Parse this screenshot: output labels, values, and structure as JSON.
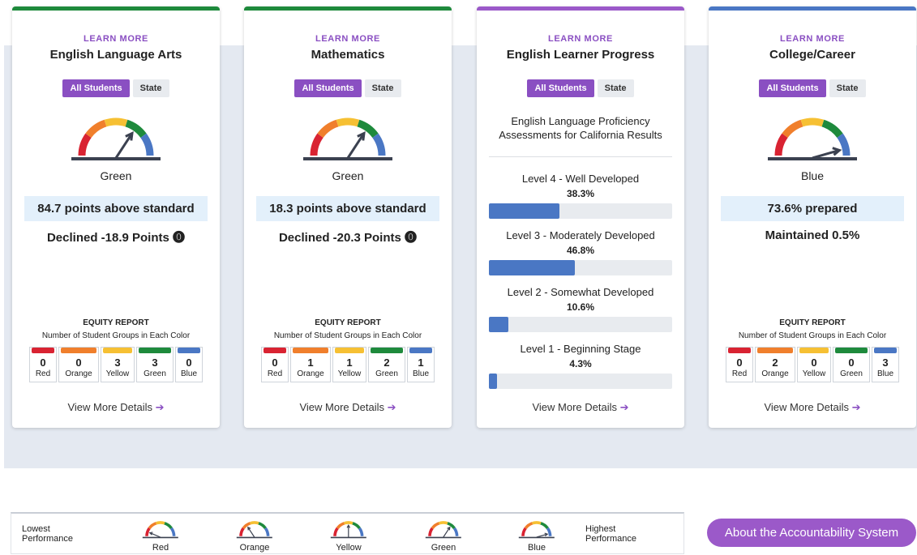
{
  "colors": {
    "red": "#d92332",
    "orange": "#f07f2c",
    "yellow": "#f6c033",
    "green": "#1e8a3c",
    "blue": "#4a77c4",
    "accent": "#8a4fc2"
  },
  "common": {
    "learn_more": "LEARN MORE",
    "all_students": "All Students",
    "state": "State",
    "equity_title": "EQUITY REPORT",
    "equity_sub": "Number of Student Groups in Each Color",
    "view_more": "View More Details",
    "arrow": "➔"
  },
  "cards": [
    {
      "title": "English Language Arts",
      "top_color": "green",
      "gauge_level": "green",
      "level_label": "Green",
      "status": "84.7 points above standard",
      "change": "Declined -18.9 Points ⓿",
      "equity": [
        {
          "label": "Red",
          "count": "0"
        },
        {
          "label": "Orange",
          "count": "0"
        },
        {
          "label": "Yellow",
          "count": "3"
        },
        {
          "label": "Green",
          "count": "3"
        },
        {
          "label": "Blue",
          "count": "0"
        }
      ]
    },
    {
      "title": "Mathematics",
      "top_color": "green",
      "gauge_level": "green",
      "level_label": "Green",
      "status": "18.3 points above standard",
      "change": "Declined -20.3 Points ⓿",
      "equity": [
        {
          "label": "Red",
          "count": "0"
        },
        {
          "label": "Orange",
          "count": "1"
        },
        {
          "label": "Yellow",
          "count": "1"
        },
        {
          "label": "Green",
          "count": "2"
        },
        {
          "label": "Blue",
          "count": "1"
        }
      ]
    },
    {
      "title": "English Learner Progress",
      "top_color": "purple",
      "subtitle_line1": "English Language Proficiency",
      "subtitle_line2": "Assessments for California Results",
      "levels": [
        {
          "name": "Level 4 - Well Developed",
          "pct": "38.3%",
          "value": 38.3
        },
        {
          "name": "Level 3 - Moderately Developed",
          "pct": "46.8%",
          "value": 46.8
        },
        {
          "name": "Level 2 - Somewhat Developed",
          "pct": "10.6%",
          "value": 10.6
        },
        {
          "name": "Level 1 - Beginning Stage",
          "pct": "4.3%",
          "value": 4.3
        }
      ]
    },
    {
      "title": "College/Career",
      "top_color": "blue",
      "gauge_level": "blue",
      "level_label": "Blue",
      "status": "73.6% prepared",
      "change": "Maintained 0.5%",
      "equity": [
        {
          "label": "Red",
          "count": "0"
        },
        {
          "label": "Orange",
          "count": "2"
        },
        {
          "label": "Yellow",
          "count": "0"
        },
        {
          "label": "Green",
          "count": "0"
        },
        {
          "label": "Blue",
          "count": "3"
        }
      ]
    }
  ],
  "legend": {
    "lowest_1": "Lowest",
    "lowest_2": "Performance",
    "highest_1": "Highest",
    "highest_2": "Performance",
    "items": [
      {
        "label": "Red",
        "level": "red"
      },
      {
        "label": "Orange",
        "level": "orange"
      },
      {
        "label": "Yellow",
        "level": "yellow"
      },
      {
        "label": "Green",
        "level": "green"
      },
      {
        "label": "Blue",
        "level": "blue"
      }
    ]
  },
  "about_button": "About the Accountability System"
}
